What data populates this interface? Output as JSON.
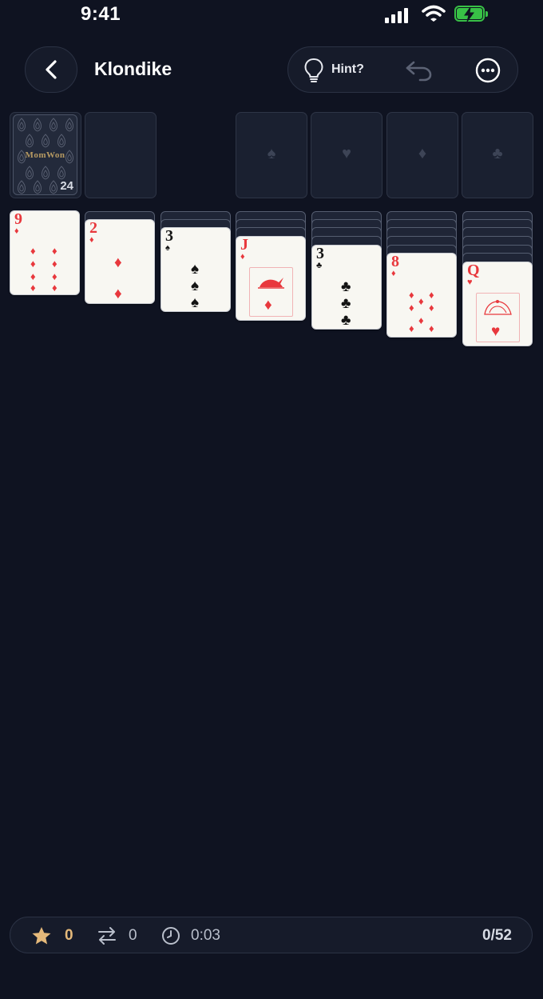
{
  "status_bar": {
    "time": "9:41"
  },
  "header": {
    "title": "Klondike",
    "hint_label": "Hint?"
  },
  "stock": {
    "logo": "MomWon",
    "count": "24"
  },
  "foundations": [
    {
      "suit": "spade",
      "symbol": "♠"
    },
    {
      "suit": "heart",
      "symbol": "♥"
    },
    {
      "suit": "diamond",
      "symbol": "♦"
    },
    {
      "suit": "club",
      "symbol": "♣"
    }
  ],
  "tableau": [
    {
      "hidden": 0,
      "rank": "9",
      "suit": "diamond",
      "symbol": "♦",
      "color": "red"
    },
    {
      "hidden": 1,
      "rank": "2",
      "suit": "diamond",
      "symbol": "♦",
      "color": "red"
    },
    {
      "hidden": 2,
      "rank": "3",
      "suit": "spade",
      "symbol": "♠",
      "color": "black"
    },
    {
      "hidden": 3,
      "rank": "J",
      "suit": "diamond",
      "symbol": "♦",
      "color": "red"
    },
    {
      "hidden": 4,
      "rank": "3",
      "suit": "club",
      "symbol": "♣",
      "color": "black"
    },
    {
      "hidden": 5,
      "rank": "8",
      "suit": "diamond",
      "symbol": "♦",
      "color": "red"
    },
    {
      "hidden": 6,
      "rank": "Q",
      "suit": "heart",
      "symbol": "♥",
      "color": "red"
    }
  ],
  "stats": {
    "score": "0",
    "moves": "0",
    "time": "0:03",
    "progress": "0/52"
  },
  "colors": {
    "background": "#0f1321",
    "accent_score": "#e5b97a",
    "red_suit": "#e8383d",
    "battery": "#38c046"
  }
}
